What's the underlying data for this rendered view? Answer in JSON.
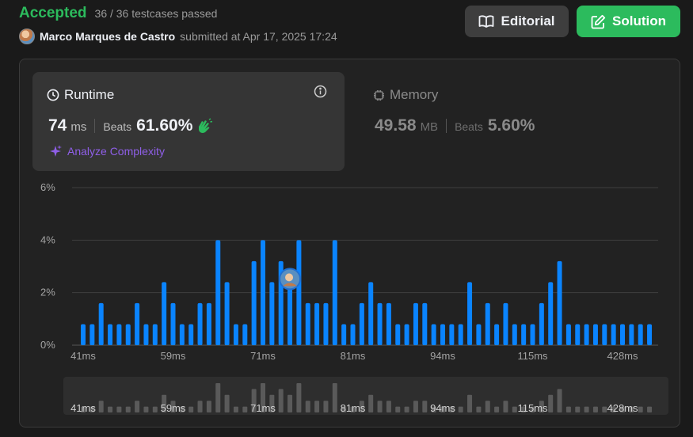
{
  "status": {
    "label": "Accepted",
    "passed": "36 / 36 testcases passed"
  },
  "submission": {
    "author": "Marco Marques de Castro",
    "meta": "submitted at Apr 17, 2025 17:24"
  },
  "buttons": {
    "editorial": "Editorial",
    "solution": "Solution"
  },
  "runtime": {
    "title": "Runtime",
    "value": "74",
    "unit": "ms",
    "beats_label": "Beats",
    "beats_value": "61.60%",
    "analyze_label": "Analyze Complexity"
  },
  "memory": {
    "title": "Memory",
    "value": "49.58",
    "unit": "MB",
    "beats_label": "Beats",
    "beats_value": "5.60%"
  },
  "colors": {
    "accent": "#2cbb5d",
    "bar": "#0a84ff",
    "bar_dim": "#5a5a5a",
    "analyze": "#8f5fe8"
  },
  "chart_data": {
    "type": "bar",
    "y_ticks": [
      "6%",
      "4%",
      "2%",
      "0%"
    ],
    "ylim": [
      0,
      6
    ],
    "x_tick_labels": [
      "41ms",
      "59ms",
      "71ms",
      "81ms",
      "94ms",
      "115ms",
      "428ms"
    ],
    "x_tick_bar_index": [
      0,
      10,
      20,
      30,
      40,
      50,
      60
    ],
    "highlight_bar_index": 23,
    "values": [
      0.8,
      0.8,
      1.6,
      0.8,
      0.8,
      0.8,
      1.6,
      0.8,
      0.8,
      2.4,
      1.6,
      0.8,
      0.8,
      1.6,
      1.6,
      4.0,
      2.4,
      0.8,
      0.8,
      3.2,
      4.0,
      2.4,
      3.2,
      2.4,
      4.0,
      1.6,
      1.6,
      1.6,
      4.0,
      0.8,
      0.8,
      1.6,
      2.4,
      1.6,
      1.6,
      0.8,
      0.8,
      1.6,
      1.6,
      0.8,
      0.8,
      0.8,
      0.8,
      2.4,
      0.8,
      1.6,
      0.8,
      1.6,
      0.8,
      0.8,
      0.8,
      1.6,
      2.4,
      3.2,
      0.8,
      0.8,
      0.8,
      0.8,
      0.8,
      0.8,
      0.8,
      0.8,
      0.8,
      0.8
    ]
  }
}
